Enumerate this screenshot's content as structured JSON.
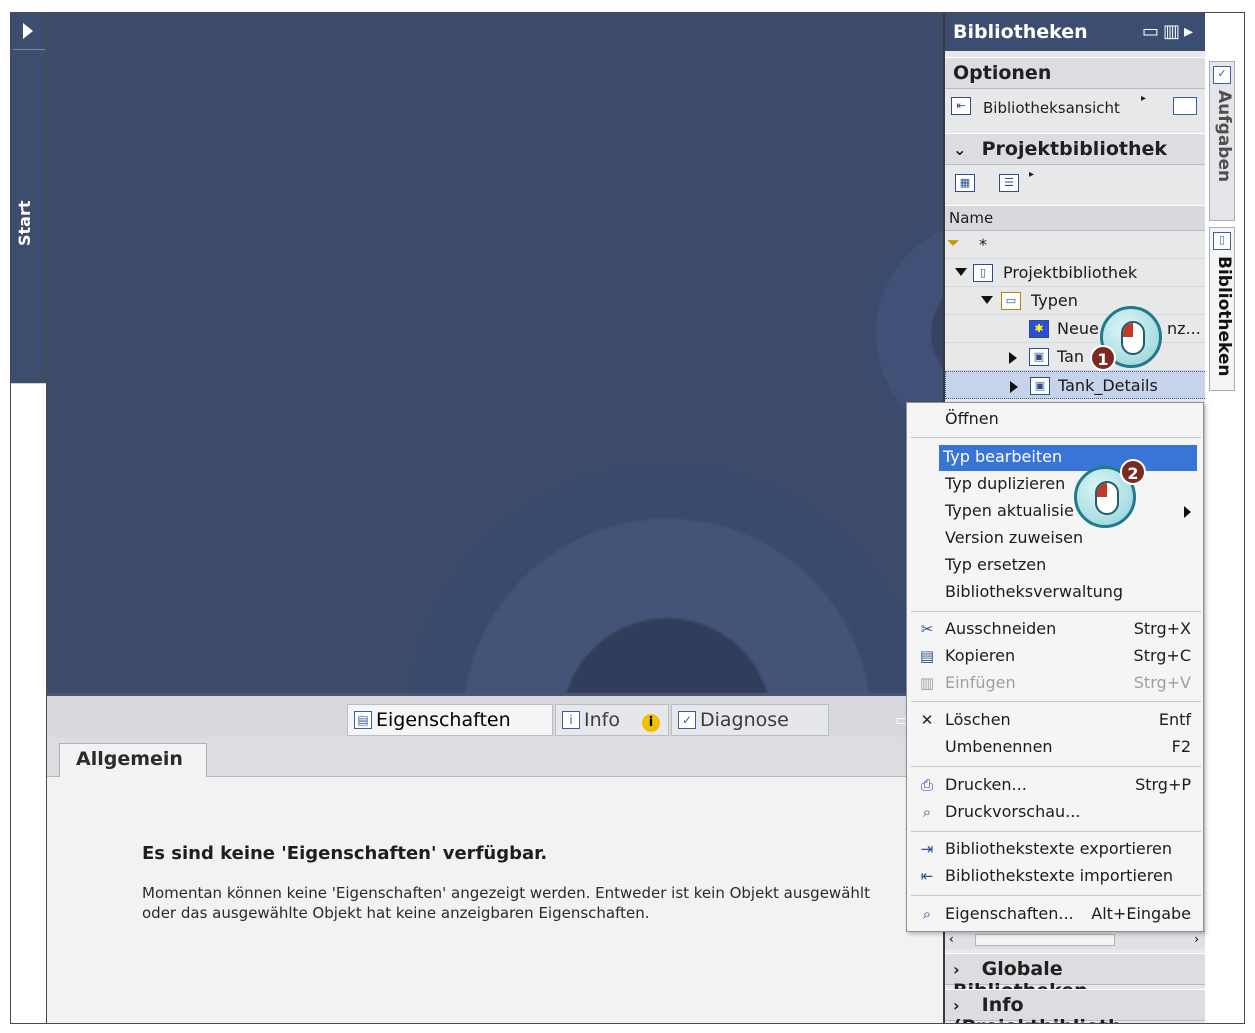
{
  "start": {
    "label": "Start"
  },
  "properties": {
    "tabs": [
      {
        "label": "Eigenschaften",
        "icon": "properties-icon"
      },
      {
        "label": "Info",
        "icon": "info-icon"
      },
      {
        "label": "Diagnose",
        "icon": "diagnostics-icon"
      }
    ],
    "subtab": "Allgemein",
    "title": "Es sind keine 'Eigenschaften' verfügbar.",
    "text": "Momentan können keine 'Eigenschaften' angezeigt werden. Entweder ist kein Objekt ausgewählt oder das ausgewählte Objekt hat keine anzeigbaren Eigenschaften."
  },
  "library": {
    "title": "Bibliotheken",
    "options_title": "Optionen",
    "view_label": "Bibliotheksansicht",
    "project_library_title": "Projektbibliothek",
    "column_name": "Name",
    "filter_value": "*",
    "tree": {
      "root": "Projektbibliothek",
      "types": "Typen",
      "new": "Neuen Typ hinzufügen",
      "new_shown": "Neue",
      "new_shown_tail": "nz...",
      "tank": "Tank",
      "tank_shown": "Tan",
      "tank_details": "Tank_Details"
    },
    "global_title": "Globale Bibliotheken",
    "info_title": "Info (Projektbiblioth..."
  },
  "side_tabs": [
    {
      "label": "Aufgaben"
    },
    {
      "label": "Bibliotheken"
    }
  ],
  "menu": {
    "items": [
      {
        "label": "Öffnen",
        "shortcut": ""
      },
      {
        "label": "Typ bearbeiten",
        "shortcut": ""
      },
      {
        "label": "Typ duplizieren",
        "shortcut": ""
      },
      {
        "label": "Typen aktualisieren",
        "shortcut": ""
      },
      {
        "label": "Version zuweisen",
        "shortcut": ""
      },
      {
        "label": "Typ ersetzen",
        "shortcut": ""
      },
      {
        "label": "Bibliotheksverwaltung",
        "shortcut": ""
      },
      {
        "label": "Ausschneiden",
        "shortcut": "Strg+X"
      },
      {
        "label": "Kopieren",
        "shortcut": "Strg+C"
      },
      {
        "label": "Einfügen",
        "shortcut": "Strg+V"
      },
      {
        "label": "Löschen",
        "shortcut": "Entf"
      },
      {
        "label": "Umbenennen",
        "shortcut": "F2"
      },
      {
        "label": "Drucken...",
        "shortcut": "Strg+P"
      },
      {
        "label": "Druckvorschau...",
        "shortcut": ""
      },
      {
        "label": "Bibliothekstexte exportieren",
        "shortcut": ""
      },
      {
        "label": "Bibliothekstexte importieren",
        "shortcut": ""
      },
      {
        "label": "Eigenschaften...",
        "shortcut": "Alt+Eingabe"
      }
    ],
    "visible": {
      "update_shown": "Typen aktualisie"
    }
  },
  "callouts": [
    {
      "number": "1"
    },
    {
      "number": "2"
    }
  ],
  "colors": {
    "work_area": "#3d4b6b",
    "header": "#3b4d70",
    "highlight": "#3875d7",
    "callout_badge": "#7a2a22"
  }
}
